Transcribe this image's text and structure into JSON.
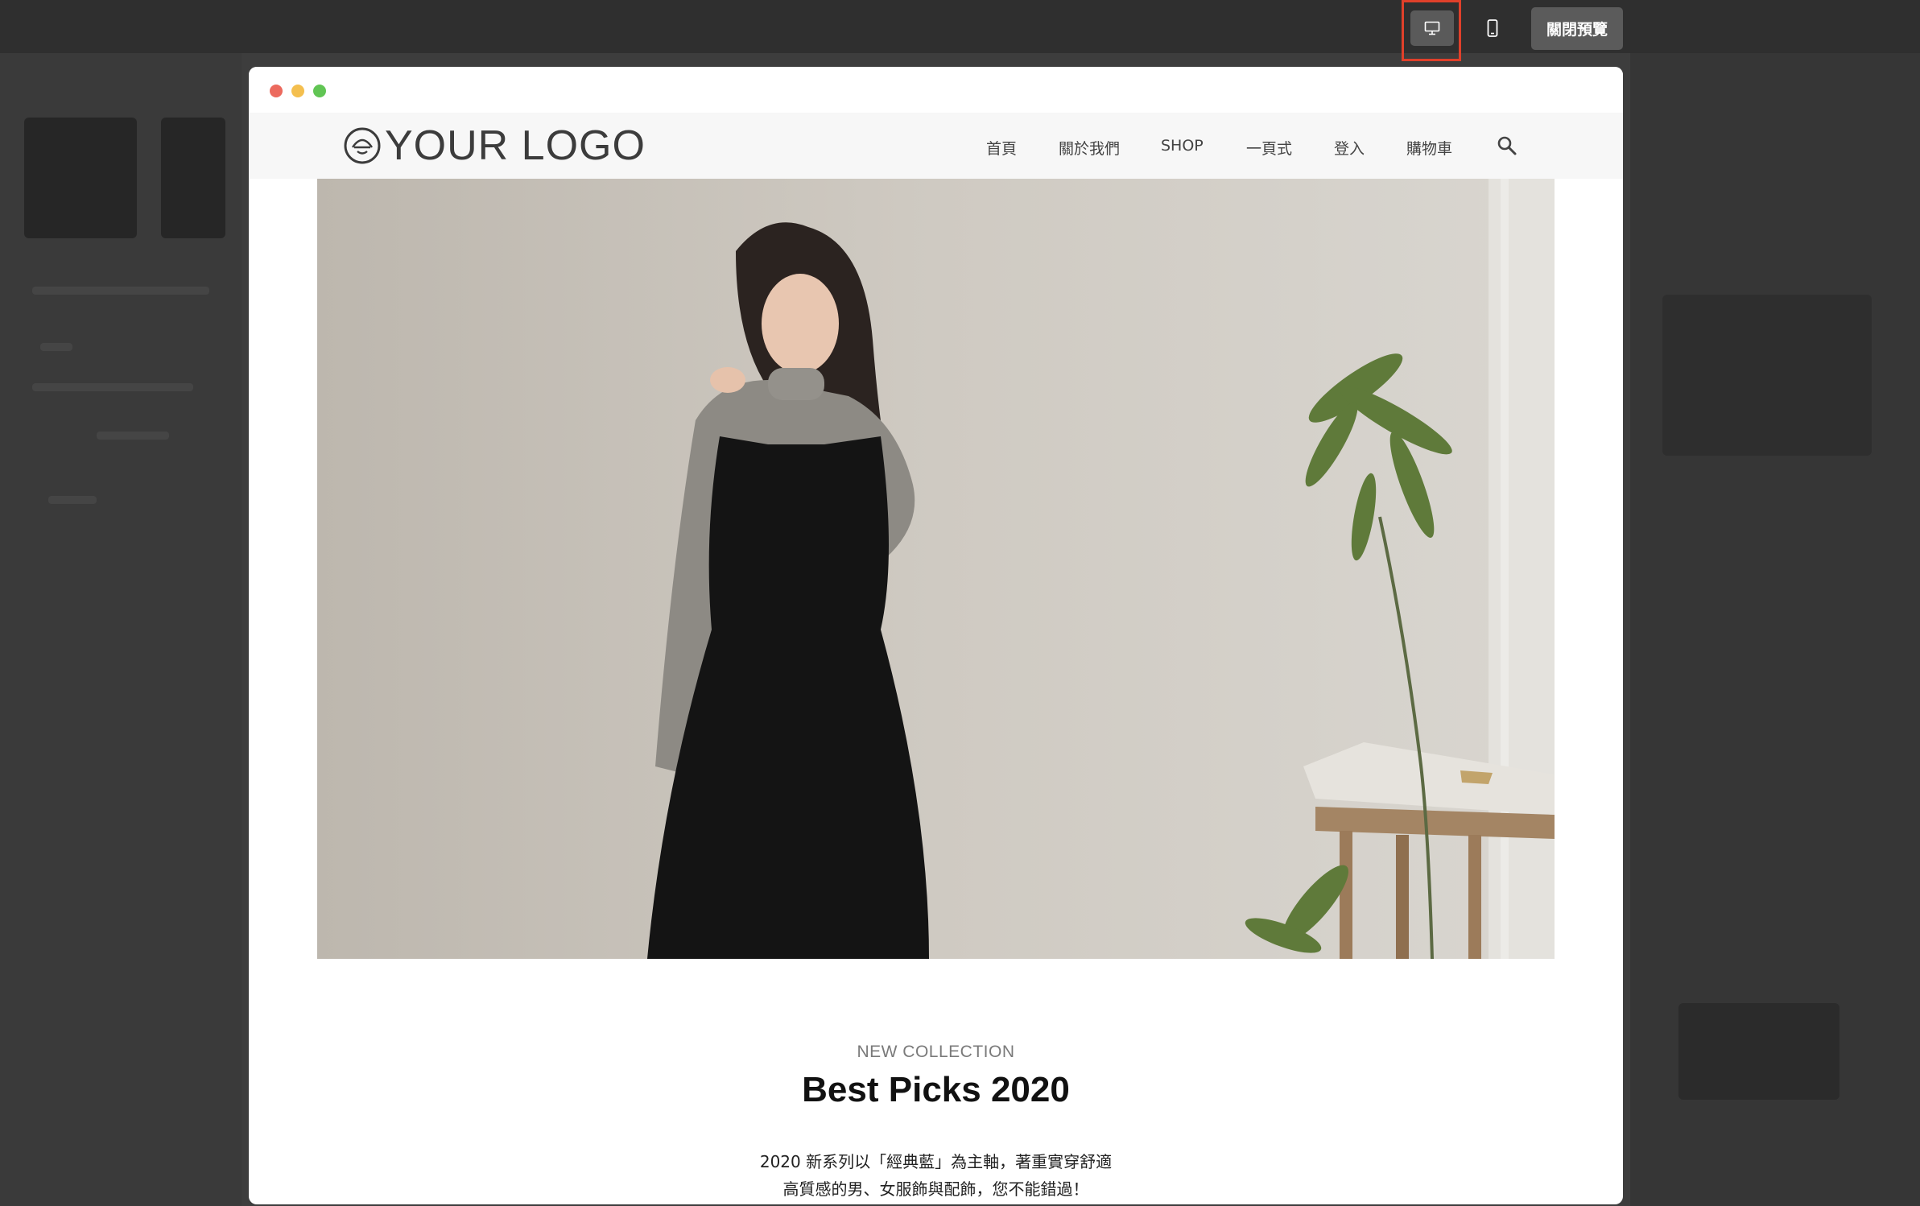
{
  "toolbar": {
    "desktop_label": "desktop-view",
    "mobile_label": "mobile-view",
    "close_preview": "關閉預覽"
  },
  "site": {
    "logo_text": "YOUR LOGO",
    "nav": [
      {
        "label": "首頁"
      },
      {
        "label": "關於我們"
      },
      {
        "label": "SHOP"
      },
      {
        "label": "一頁式"
      },
      {
        "label": "登入"
      },
      {
        "label": "購物車"
      }
    ]
  },
  "hero": {
    "image_alt": ""
  },
  "collection": {
    "label": "NEW COLLECTION",
    "title": "Best Picks 2020",
    "desc_line1": "2020 新系列以「經典藍」為主軸，著重實穿舒適",
    "desc_line2": "高質感的男、女服飾與配飾，您不能錯過！"
  },
  "colors": {
    "highlight": "#e0402a",
    "dot_red": "#ec6a5e",
    "dot_yellow": "#f4bf4f",
    "dot_green": "#61c554"
  }
}
